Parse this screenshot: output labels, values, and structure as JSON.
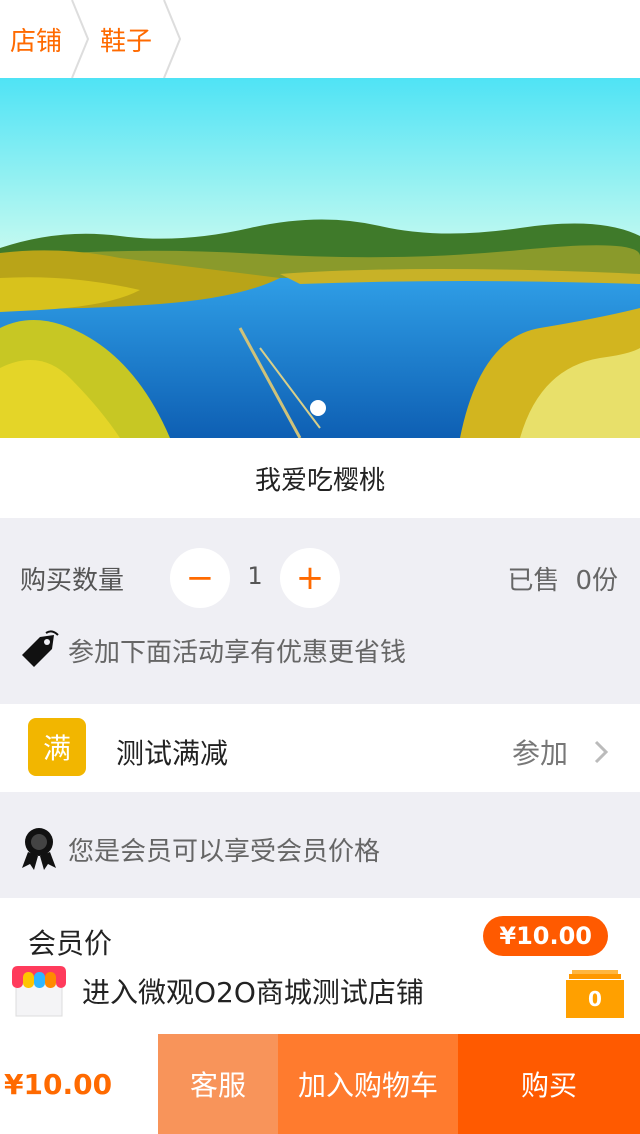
{
  "breadcrumb": {
    "items": [
      "店铺",
      "鞋子"
    ]
  },
  "product": {
    "title": "我爱吃樱桃"
  },
  "quantity": {
    "label": "购买数量",
    "minus": "−",
    "value": "1",
    "plus": "+"
  },
  "sales": {
    "label": "已售",
    "count": "0份"
  },
  "promo": {
    "hint": "参加下面活动享有优惠更省钱"
  },
  "activity": {
    "badge": "满",
    "name": "测试满减",
    "action": "参加"
  },
  "member": {
    "hint": "您是会员可以享受会员价格",
    "price_label": "会员价",
    "price": "¥10.00"
  },
  "shop": {
    "name": "进入微观O2O商城测试店铺"
  },
  "cart": {
    "count": "0"
  },
  "bottom_bar": {
    "total": "¥10.00",
    "service": "客服",
    "add_to_cart": "加入购物车",
    "buy": "购买"
  },
  "colors": {
    "accent": "#ff6a00",
    "badge": "#f2b600",
    "cart": "#ffa000",
    "service": "#f8945a",
    "add_to_cart": "#ff7b2e",
    "buy": "#ff5a00"
  },
  "icons": [
    "chevron-right-icon",
    "price-tag-icon",
    "chevron-right-icon",
    "member-ribbon-icon",
    "shop-awning-icon",
    "cart-icon"
  ]
}
